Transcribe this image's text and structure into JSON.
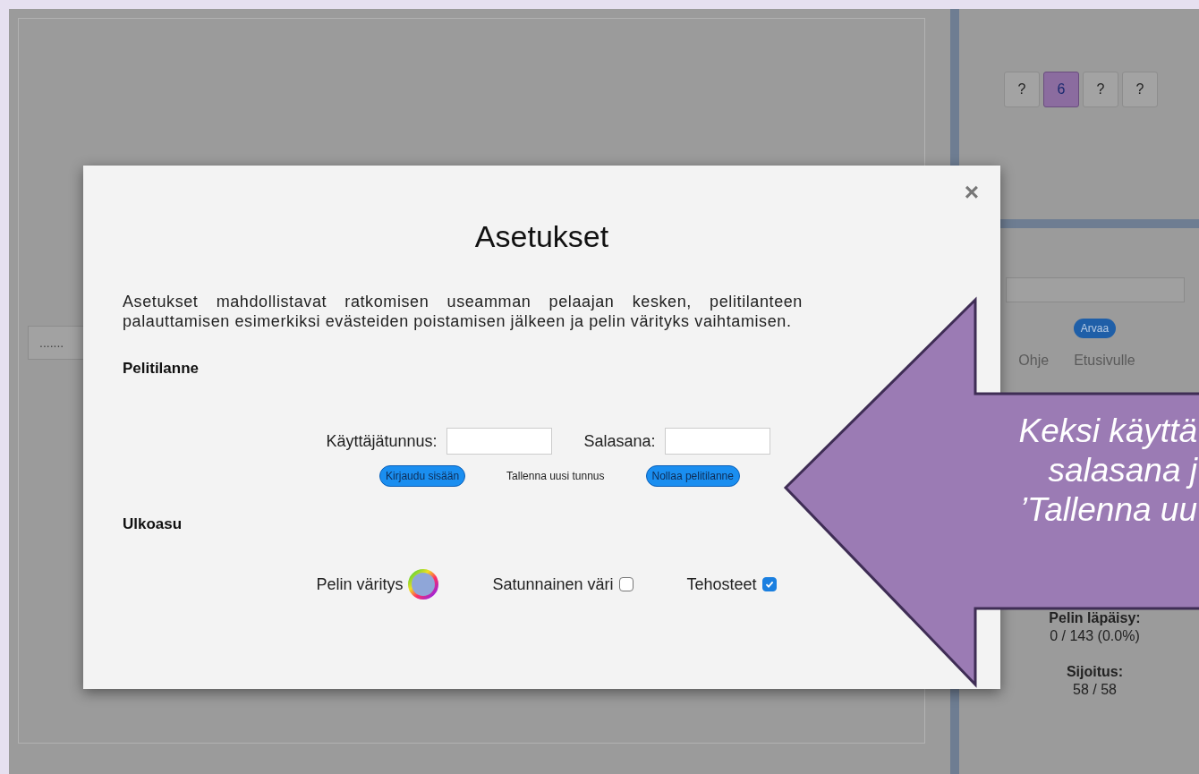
{
  "background": {
    "side_button": ".......",
    "digits": [
      {
        "label": "?",
        "selected": false
      },
      {
        "label": "6",
        "selected": true
      },
      {
        "label": "?",
        "selected": false
      },
      {
        "label": "?",
        "selected": false
      }
    ],
    "guess_button": "Arvaa",
    "links": [
      "Ohje",
      "Etusivulle"
    ],
    "stats": [
      {
        "label": "Pelin läpäisy:",
        "value": "0 / 143 (0.0%)"
      },
      {
        "label": "Sijoitus:",
        "value": "58 / 58"
      }
    ]
  },
  "dialog": {
    "title": "Asetukset",
    "close": "×",
    "intro": "Asetukset mahdollistavat ratkomisen useamman pelaajan kesken, pelitilanteen palauttamisen esimerkiksi evästeiden poistamisen jälkeen ja pelin värityks vaihtamisen.",
    "sections": [
      {
        "heading": "Pelitilanne",
        "fields": [
          {
            "label": "Käyttäjätunnus:"
          },
          {
            "label": "Salasana:"
          }
        ],
        "buttons": [
          {
            "label": "Kirjaudu sisään",
            "primary": true
          },
          {
            "label": "Tallenna uusi tunnus",
            "primary": false
          },
          {
            "label": "Nollaa pelitilanne",
            "primary": true
          }
        ]
      },
      {
        "heading": "Ulkoasu",
        "options": [
          {
            "kind": "color",
            "label": "Pelin väritys"
          },
          {
            "kind": "checkbox",
            "label": "Satunnainen väri",
            "checked": false
          },
          {
            "kind": "checkbox",
            "label": "Tehosteet",
            "checked": true
          }
        ]
      }
    ]
  },
  "callout": {
    "lines": [
      "Keksi käyttä",
      "salasana j",
      "’Tallenna uu"
    ]
  }
}
